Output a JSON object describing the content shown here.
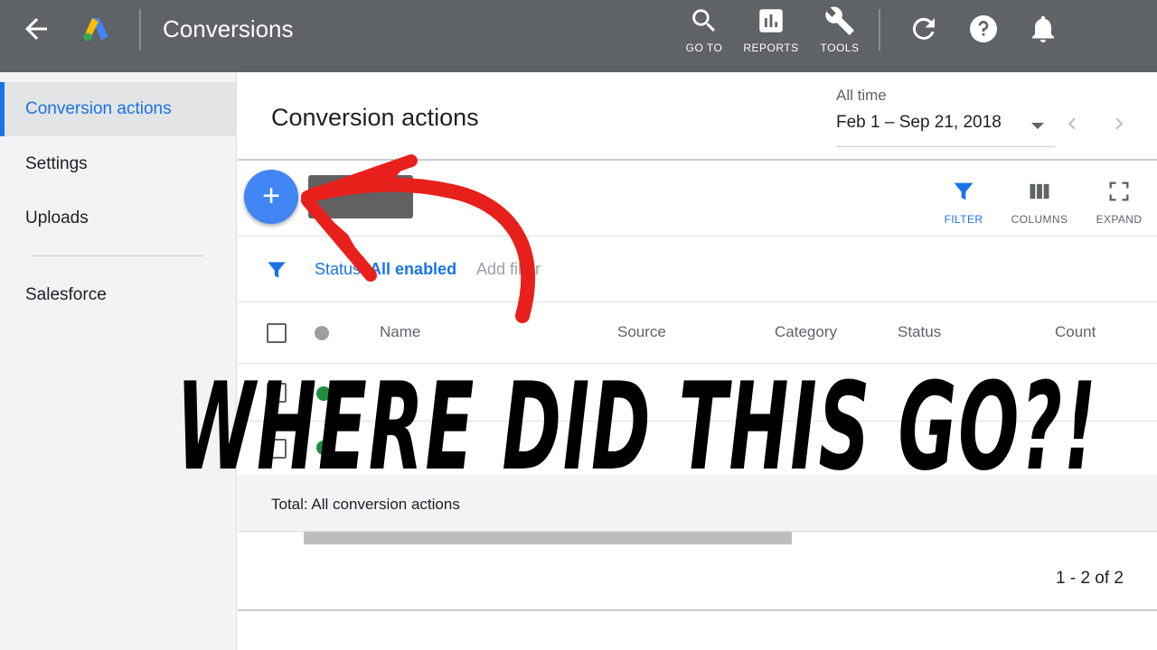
{
  "topbar": {
    "title": "Conversions",
    "tools": [
      {
        "label": "GO TO",
        "icon": "search-icon"
      },
      {
        "label": "REPORTS",
        "icon": "reports-icon"
      },
      {
        "label": "TOOLS",
        "icon": "wrench-icon"
      }
    ],
    "colors": {
      "bar": "#5f6266",
      "text": "#ffffff"
    }
  },
  "sidebar": {
    "items": [
      {
        "label": "Conversion actions",
        "active": true
      },
      {
        "label": "Settings",
        "active": false
      },
      {
        "label": "Uploads",
        "active": false
      },
      {
        "label": "Salesforce",
        "active": false
      }
    ]
  },
  "header": {
    "title": "Conversion actions",
    "date_label": "All time",
    "date_range": "Feb 1 – Sep 21, 2018"
  },
  "toolbar": {
    "add_icon": "+",
    "actions": [
      {
        "label": "FILTER",
        "icon": "filter-icon"
      },
      {
        "label": "COLUMNS",
        "icon": "columns-icon"
      },
      {
        "label": "EXPAND",
        "icon": "expand-icon"
      }
    ]
  },
  "filters": {
    "status_label": "Status",
    "status_value": "All enabled",
    "add_filter": "Add filter"
  },
  "table": {
    "columns": [
      "Name",
      "Source",
      "Category",
      "Status",
      "Count"
    ],
    "rows": [
      {
        "status_color": "#1e8e3e"
      },
      {
        "status_color": "#1e8e3e"
      }
    ],
    "total_label": "Total: All conversion actions",
    "pagination": "1 - 2 of 2"
  },
  "annotation": {
    "headline": "WHERE DID THIS GO?!",
    "arrow_color": "#e8201b"
  },
  "colors": {
    "accent": "#1a73e8",
    "fab": "#4285f4"
  }
}
